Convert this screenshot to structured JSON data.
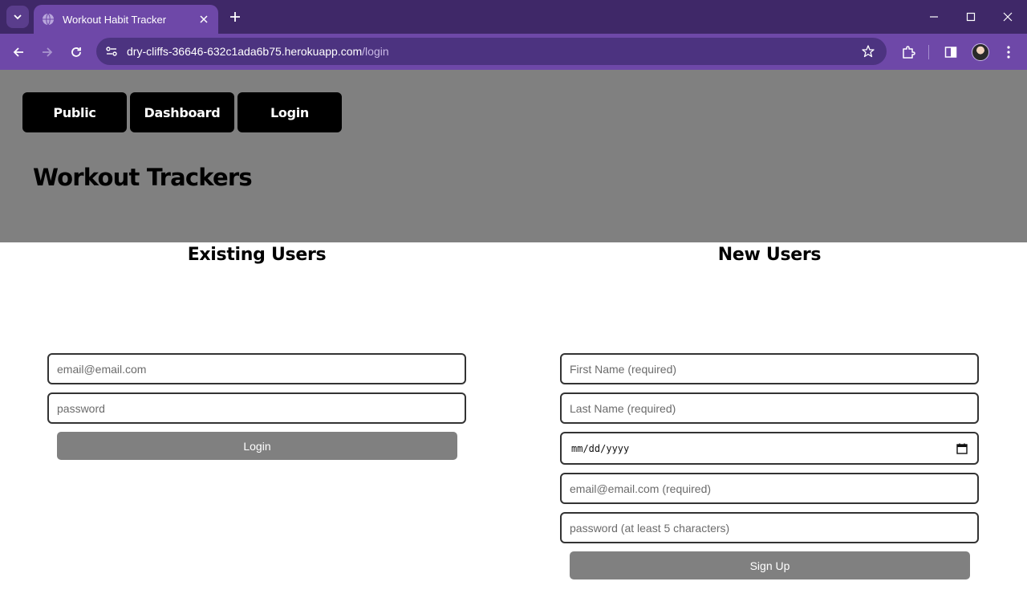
{
  "browser": {
    "tab_title": "Workout Habit Tracker",
    "url_host": "dry-cliffs-36646-632c1ada6b75.herokuapp.com",
    "url_path": "/login",
    "accent": "#6e48a8"
  },
  "nav": {
    "links": [
      "Public",
      "Dashboard",
      "Login"
    ]
  },
  "site": {
    "title": "Workout Trackers",
    "header_bg": "#808080"
  },
  "existing_users": {
    "heading": "Existing Users",
    "email_placeholder": "email@email.com",
    "password_placeholder": "password",
    "submit_label": "Login"
  },
  "new_users": {
    "heading": "New Users",
    "first_name_placeholder": "First Name (required)",
    "last_name_placeholder": "Last Name (required)",
    "birthdate_placeholder": "mm/dd/yyyy",
    "email_placeholder": "email@email.com (required)",
    "password_placeholder": "password (at least 5 characters)",
    "submit_label": "Sign Up"
  }
}
